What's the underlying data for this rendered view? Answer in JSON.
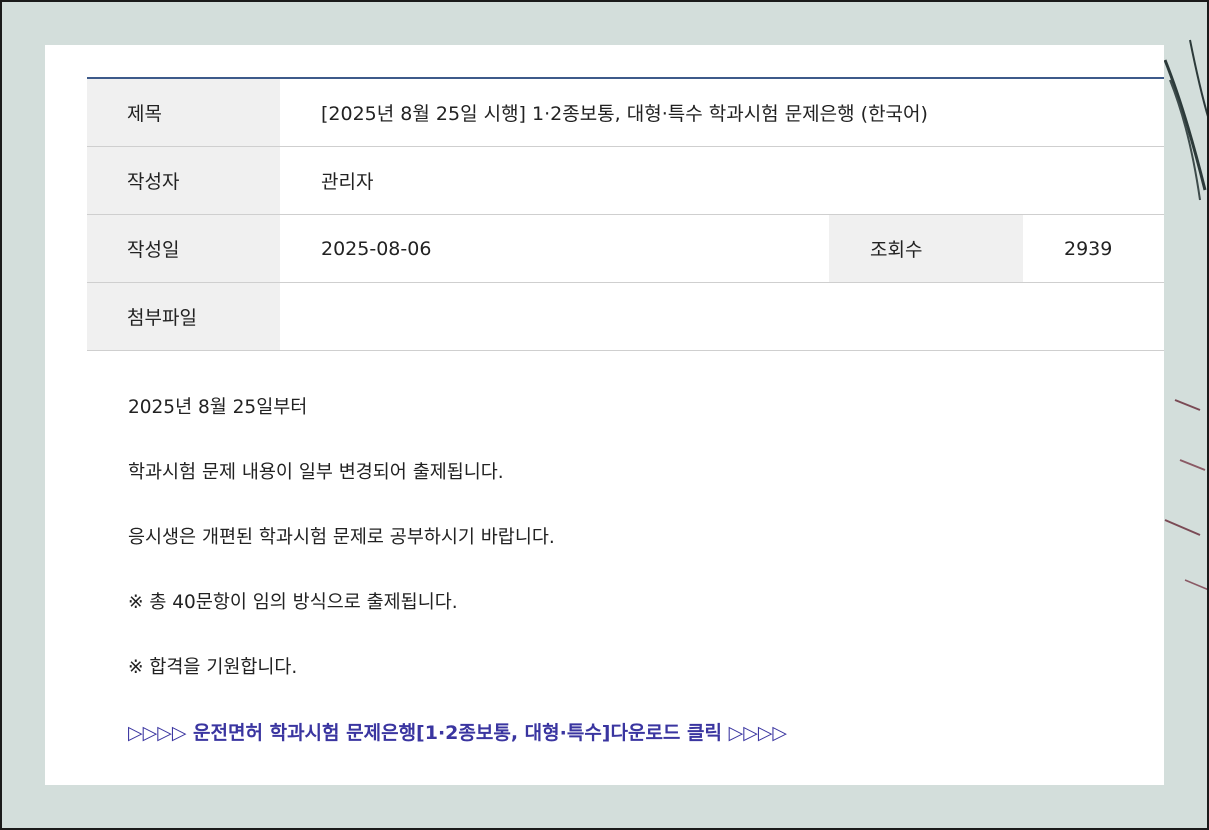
{
  "post": {
    "title_label": "제목",
    "title": "[2025년 8월 25일 시행] 1·2종보통, 대형·특수 학과시험 문제은행 (한국어)",
    "author_label": "작성자",
    "author": "관리자",
    "date_label": "작성일",
    "date": "2025-08-06",
    "views_label": "조회수",
    "views": "2939",
    "attachment_label": "첨부파일",
    "attachment": ""
  },
  "body": {
    "lines": [
      "2025년 8월 25일부터",
      "학과시험 문제 내용이 일부 변경되어 출제됩니다.",
      "응시생은 개편된 학과시험 문제로 공부하시기 바랍니다.",
      "※ 총 40문항이 임의 방식으로 출제됩니다.",
      "※ 합격을 기원합니다."
    ],
    "download_link": "▷▷▷▷ 운전면허 학과시험 문제은행[1·2종보통, 대형·특수]다운로드 클릭 ▷▷▷▷"
  },
  "colors": {
    "table_top_border": "#3d5a8a",
    "header_bg": "#f0f0f0",
    "link": "#3a35a0",
    "background": "#d3dedb"
  }
}
